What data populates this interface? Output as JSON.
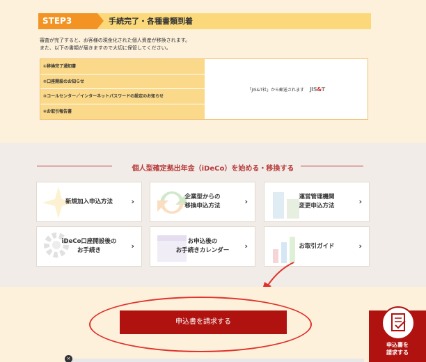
{
  "step3": {
    "tag": "STEP3",
    "title": "手続完了・各種書類到着",
    "desc_line1": "審査が完了すると、お客様の現金化された個人資産が移換されます。",
    "desc_line2": "また、以下の書類が届きますので大切に保管してください。",
    "documents": [
      "①移換完了通知書",
      "②口座開設のお知らせ",
      "③コールセンター／インターネットパスワードの設定のお知らせ",
      "④お取引報告書"
    ],
    "note": "「JIS&T社」から郵送されます",
    "logo": {
      "pre": "JIS",
      "amp": "&",
      "post": "T"
    }
  },
  "ideco": {
    "heading": "個人型確定拠出年金（iDeCo）を始める・移換する",
    "cards": [
      {
        "line1": "新規加入申込方法",
        "line2": ""
      },
      {
        "line1": "企業型からの",
        "line2": "移換申込方法"
      },
      {
        "line1": "運営管理機関",
        "line2": "変更申込方法"
      },
      {
        "line1": "iDeCo口座開設後の",
        "line2": "お手続き"
      },
      {
        "line1": "お申込後の",
        "line2": "お手続きカレンダー"
      },
      {
        "line1": "お取引ガイド",
        "line2": ""
      }
    ],
    "arrow": "›"
  },
  "request": {
    "button": "申込書を請求する",
    "side_line1": "申込書を",
    "side_line2": "請求する"
  },
  "close_glyph": "×",
  "colors": {
    "accent": "#b0120f",
    "step": "#f29323",
    "annotation": "#e0322b"
  }
}
